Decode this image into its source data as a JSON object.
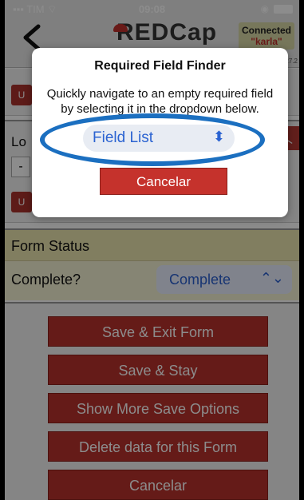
{
  "status_bar": {
    "carrier": "TIM",
    "time": "09:08"
  },
  "header": {
    "app_name": "REDCap",
    "connection_status": "Connected",
    "username": "\"karla\"",
    "version": "5.27.2"
  },
  "form": {
    "section_top_button": "U",
    "location_label": "Lo",
    "location_minus": "-",
    "location_button": "U",
    "form_status_title": "Form Status",
    "complete_label": "Complete?",
    "complete_value": "Complete",
    "buttons": [
      "Save & Exit Form",
      "Save & Stay",
      "Show More Save Options",
      "Delete data for this Form",
      "Cancelar"
    ]
  },
  "modal": {
    "title": "Required Field Finder",
    "message": "Quickly navigate to an empty required field by selecting it in the dropdown below.",
    "select_value": "Field List",
    "cancel_label": "Cancelar",
    "highlight_color": "#1b6fc0"
  },
  "colors": {
    "brand_red": "#b8322c",
    "select_blue": "#2b63d1"
  }
}
